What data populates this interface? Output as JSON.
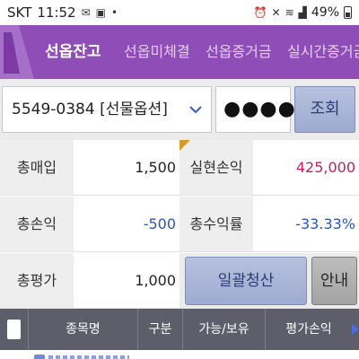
{
  "status_bar": {
    "carrier": "SKT",
    "time": "11:52",
    "battery": "49%"
  },
  "tabs": [
    {
      "label": "선옵잔고",
      "active": true
    },
    {
      "label": "선옵미체결",
      "active": false
    },
    {
      "label": "선옵증거금",
      "active": false
    },
    {
      "label": "실시간증거금",
      "active": false
    }
  ],
  "account": {
    "selected": "5549-0384 [선물옵션]",
    "password_masked": "●●●●",
    "query_label": "조회"
  },
  "summary": {
    "total_buy_label": "총매입",
    "total_buy_value": "1,500",
    "realized_pl_label": "실현손익",
    "realized_pl_value": "425,000",
    "total_pl_label": "총손익",
    "total_pl_value": "-500",
    "total_return_label": "총수익률",
    "total_return_value": "-33.33%",
    "total_eval_label": "총평가",
    "total_eval_value": "1,000",
    "bulk_settle_label": "일괄청산",
    "guide_label": "안내"
  },
  "table": {
    "columns": [
      "종목명",
      "구분",
      "가능/보유",
      "평가손익"
    ]
  },
  "colors": {
    "tab_bar": "#8f4db8",
    "negative": "#2f54b3",
    "positive": "#c0205f",
    "table_header": "#5d5e6a"
  },
  "icons": [
    "message-icon",
    "gallery-icon",
    "alarm-icon",
    "mute-icon",
    "wifi-icon",
    "signal-icon",
    "battery-icon",
    "chevron-down-icon"
  ]
}
